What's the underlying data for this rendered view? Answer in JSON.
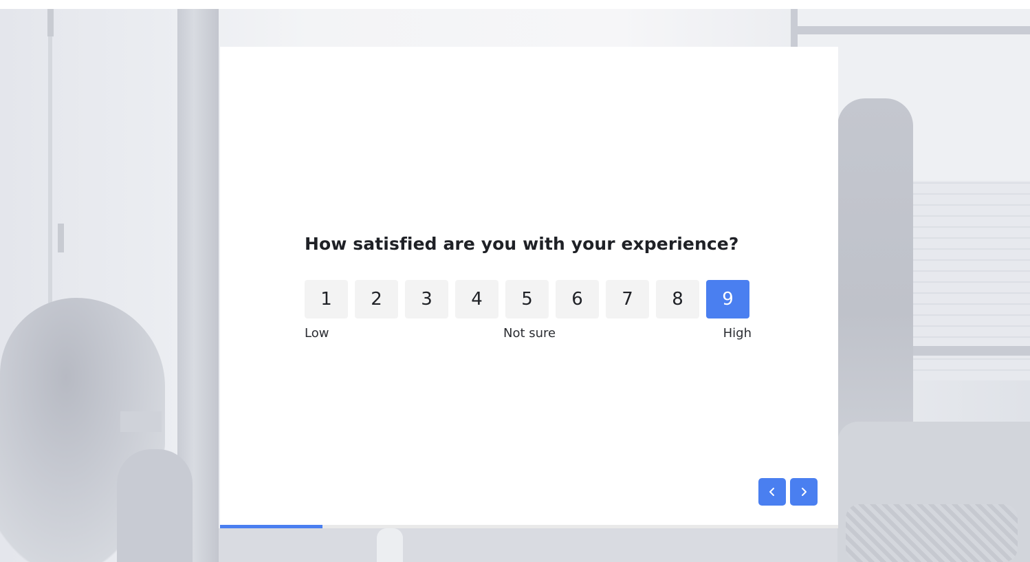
{
  "survey": {
    "question": "How satisfied are you with your experience?",
    "scale": {
      "options": [
        "1",
        "2",
        "3",
        "4",
        "5",
        "6",
        "7",
        "8",
        "9"
      ],
      "selected": "9",
      "label_low": "Low",
      "label_mid": "Not sure",
      "label_high": "High"
    },
    "progress_fraction": 0.166
  },
  "navigation": {
    "prev_icon": "chevron-left-icon",
    "next_icon": "chevron-right-icon"
  },
  "colors": {
    "accent": "#4a7ff0",
    "option_bg": "#f3f3f3",
    "text": "#1f2126"
  }
}
